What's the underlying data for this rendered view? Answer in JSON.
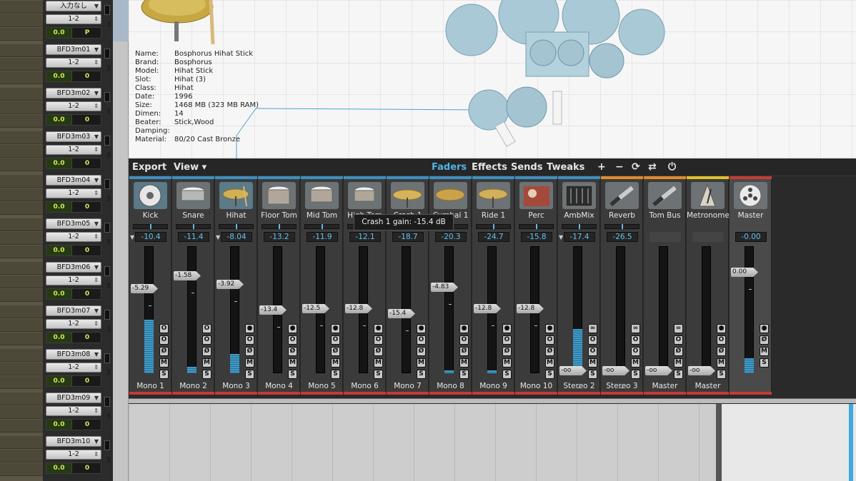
{
  "tracks": [
    {
      "input": "入力なし",
      "output": "1-2",
      "vol": "0.0",
      "pan": "P",
      "extra": "P",
      "num": "3"
    },
    {
      "input": "BFD3m01",
      "output": "1-2",
      "vol": "0.0",
      "pan": "0",
      "extra": "",
      "num": "3"
    },
    {
      "input": "BFD3m02",
      "output": "1-2",
      "vol": "0.0",
      "pan": "0",
      "extra": "",
      "num": "3"
    },
    {
      "input": "BFD3m03",
      "output": "1-2",
      "vol": "0.0",
      "pan": "0",
      "extra": "",
      "num": "3"
    },
    {
      "input": "BFD3m04",
      "output": "1-2",
      "vol": "0.0",
      "pan": "0",
      "extra": "",
      "num": "3"
    },
    {
      "input": "BFD3m05",
      "output": "1-2",
      "vol": "0.0",
      "pan": "0",
      "extra": "",
      "num": "3"
    },
    {
      "input": "BFD3m06",
      "output": "1-2",
      "vol": "0.0",
      "pan": "0",
      "extra": "",
      "num": "3"
    },
    {
      "input": "BFD3m07",
      "output": "1-2",
      "vol": "0.0",
      "pan": "0",
      "extra": "",
      "num": "3"
    },
    {
      "input": "BFD3m08",
      "output": "1-2",
      "vol": "0.0",
      "pan": "0",
      "extra": "",
      "num": "3"
    },
    {
      "input": "BFD3m09",
      "output": "1-2",
      "vol": "0.0",
      "pan": "0",
      "extra": "",
      "num": "3"
    },
    {
      "input": "BFD3m10",
      "output": "1-2",
      "vol": "0.0",
      "pan": "0",
      "extra": "",
      "num": "3"
    }
  ],
  "kit_info": [
    {
      "k": "Name:",
      "v": "Bosphorus Hihat Stick"
    },
    {
      "k": "Brand:",
      "v": "Bosphorus"
    },
    {
      "k": "Model:",
      "v": "Hihat Stick"
    },
    {
      "k": "Slot:",
      "v": "Hihat (3)"
    },
    {
      "k": "Class:",
      "v": "Hihat"
    },
    {
      "k": "Date:",
      "v": "1996"
    },
    {
      "k": "Size:",
      "v": "1468 MB (323 MB RAM)"
    },
    {
      "k": "Dimen:",
      "v": "14"
    },
    {
      "k": "Beater:",
      "v": "Stick,Wood"
    },
    {
      "k": "Damping:",
      "v": ""
    },
    {
      "k": "Material:",
      "v": "80/20 Cast Bronze"
    }
  ],
  "mixer_bar": {
    "export": "Export",
    "view": "View ▾",
    "faders": "Faders",
    "effects": "Effects",
    "sends": "Sends",
    "tweaks": "Tweaks",
    "add": "+",
    "remove": "−",
    "refresh": "⟳",
    "route": "⇄",
    "power": "⏻"
  },
  "tooltip": "Crash 1 gain: -15.4 dB",
  "channels": [
    {
      "label": "Kick",
      "gain": "-10.4",
      "fader": "-5.29",
      "meter": 0.42,
      "out": "Mono 1",
      "topcolor": "#3e8fc0",
      "icon": "kick-drum-icon",
      "dd": true,
      "selected": true,
      "btns": [
        "O",
        "O",
        "Ø",
        "M",
        "S"
      ],
      "fader_level": 0.33
    },
    {
      "label": "Snare",
      "gain": "-11.4",
      "fader": "-1.58",
      "meter": 0.05,
      "out": "Mono 2",
      "topcolor": "#3e8fc0",
      "icon": "snare-drum-icon",
      "dd": false,
      "selected": false,
      "btns": [
        "O",
        "O",
        "Ø",
        "M",
        "S"
      ],
      "fader_level": 0.23
    },
    {
      "label": "Hihat",
      "gain": "-8.04",
      "fader": "-3.92",
      "meter": 0.15,
      "out": "Mono 3",
      "topcolor": "#3e8fc0",
      "icon": "hihat-icon",
      "dd": true,
      "selected": true,
      "btns": [
        "●",
        "O",
        "Ø",
        "M",
        "S"
      ],
      "fader_level": 0.3
    },
    {
      "label": "Floor Tom",
      "gain": "-13.2",
      "fader": "-13.4",
      "meter": 0,
      "out": "Mono 4",
      "topcolor": "#3e8fc0",
      "icon": "floor-tom-icon",
      "dd": false,
      "selected": false,
      "btns": [
        "●",
        "O",
        "Ø",
        "M",
        "S"
      ],
      "fader_level": 0.5
    },
    {
      "label": "Mid Tom",
      "gain": "-11.9",
      "fader": "-12.5",
      "meter": 0,
      "out": "Mono 5",
      "topcolor": "#3e8fc0",
      "icon": "mid-tom-icon",
      "dd": false,
      "selected": false,
      "btns": [
        "●",
        "O",
        "Ø",
        "M",
        "S"
      ],
      "fader_level": 0.49
    },
    {
      "label": "High Tom",
      "gain": "-12.1",
      "fader": "-12.8",
      "meter": 0,
      "out": "Mono 6",
      "topcolor": "#3e8fc0",
      "icon": "high-tom-icon",
      "dd": false,
      "selected": false,
      "btns": [
        "●",
        "O",
        "Ø",
        "M",
        "S"
      ],
      "fader_level": 0.49
    },
    {
      "label": "Crash 1",
      "gain": "-18.7",
      "fader": "-15.4",
      "meter": 0,
      "out": "Mono 7",
      "topcolor": "#3e8fc0",
      "icon": "crash-cymbal-icon",
      "dd": false,
      "selected": false,
      "btns": [
        "●",
        "O",
        "Ø",
        "M",
        "S"
      ],
      "fader_level": 0.53
    },
    {
      "label": "Cymbal 1",
      "gain": "-20.3",
      "fader": "-4.83",
      "meter": 0.02,
      "out": "Mono 8",
      "topcolor": "#3e8fc0",
      "icon": "cymbal-icon",
      "dd": false,
      "selected": false,
      "btns": [
        "●",
        "O",
        "Ø",
        "M",
        "S"
      ],
      "fader_level": 0.32
    },
    {
      "label": "Ride 1",
      "gain": "-24.7",
      "fader": "-12.8",
      "meter": 0.02,
      "out": "Mono 9",
      "topcolor": "#3e8fc0",
      "icon": "ride-cymbal-icon",
      "dd": false,
      "selected": false,
      "btns": [
        "●",
        "O",
        "Ø",
        "M",
        "S"
      ],
      "fader_level": 0.49
    },
    {
      "label": "Perc",
      "gain": "-15.8",
      "fader": "-12.8",
      "meter": 0,
      "out": "Mono 10",
      "topcolor": "#3e8fc0",
      "icon": "percussion-icon",
      "dd": false,
      "selected": false,
      "btns": [
        "●",
        "O",
        "Ø",
        "M",
        "S"
      ],
      "fader_level": 0.49
    },
    {
      "label": "AmbMix",
      "gain": "-17.4",
      "fader": "-oo",
      "meter": 0.35,
      "out": "Stereo 2",
      "topcolor": "#3e8fc0",
      "icon": "ambient-mixer-icon",
      "dd": true,
      "selected": false,
      "btns": [
        "∞",
        "O",
        "O",
        "M",
        "S"
      ],
      "fader_level": 0.98
    },
    {
      "label": "Reverb",
      "gain": "-26.5",
      "fader": "-oo",
      "meter": 0.03,
      "out": "Stereo 3",
      "topcolor": "#e08a2a",
      "icon": "reverb-jack-icon",
      "dd": false,
      "selected": false,
      "btns": [
        "∞",
        "O",
        "O",
        "M",
        "S"
      ],
      "fader_level": 0.98
    },
    {
      "label": "Tom Bus",
      "gain": "",
      "fader": "-oo",
      "meter": 0,
      "out": "Master",
      "topcolor": "#e08a2a",
      "icon": "bus-jack-icon",
      "dd": false,
      "selected": false,
      "btns": [
        "∞",
        "O",
        "Ø",
        "M",
        "S"
      ],
      "fader_level": 0.98
    },
    {
      "label": "Metronome",
      "gain": "",
      "fader": "-oo",
      "meter": 0,
      "out": "Master",
      "topcolor": "#e0c02a",
      "icon": "metronome-icon",
      "dd": false,
      "selected": false,
      "btns": [
        "●",
        "O",
        "Ø",
        "M",
        "S"
      ],
      "fader_level": 0.98
    },
    {
      "label": "Master",
      "gain": "-0.00",
      "fader": "0.00",
      "meter": 0.12,
      "out": "",
      "topcolor": "#c63a35",
      "icon": "master-reel-icon",
      "dd": false,
      "selected": false,
      "master": true,
      "btns": [
        "●",
        "Ø",
        "M",
        "S"
      ],
      "fader_level": 0.2
    }
  ]
}
